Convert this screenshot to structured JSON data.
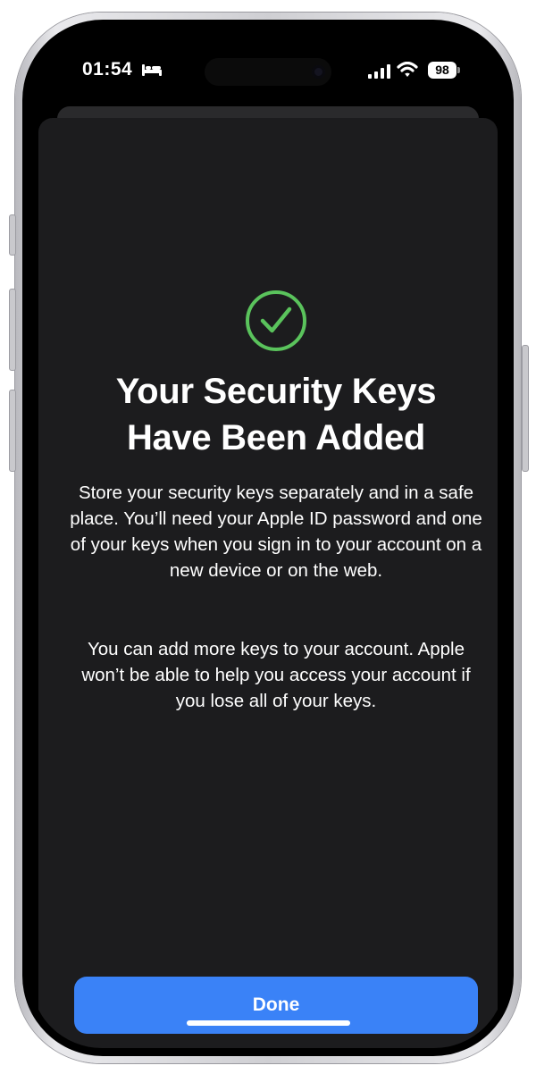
{
  "status_bar": {
    "time": "01:54",
    "battery_level": "98",
    "icons": [
      "bed-icon",
      "signal-icon",
      "wifi-icon",
      "battery-icon"
    ]
  },
  "content": {
    "title_line1": "Your Security Keys",
    "title_line2": "Have Been Added",
    "paragraph1": "Store your security keys separately and in a safe place. You’ll need your Apple ID password and one of your keys when you sign in to your account on a new device or on the web.",
    "paragraph2": "You can add more keys to your account. Apple won’t be able to help you access your account if you lose all of your keys."
  },
  "actions": {
    "done_label": "Done"
  },
  "colors": {
    "accent": "#3a82f7",
    "success": "#5ac35c",
    "sheet_background": "#1c1c1e",
    "text": "#ffffff"
  }
}
